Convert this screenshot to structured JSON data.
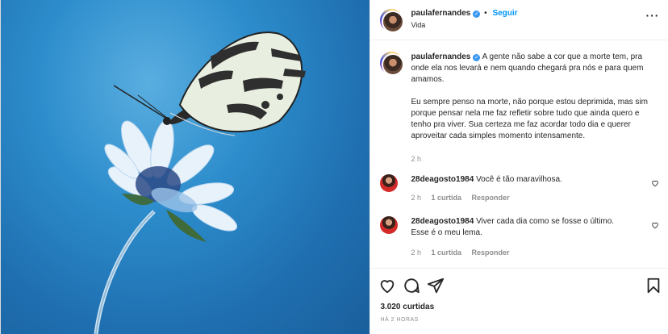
{
  "header": {
    "username": "paulafernandes",
    "follow_label": "Seguir",
    "location": "Vida",
    "more_icon": "more-horizontal-icon"
  },
  "caption": {
    "username": "paulafernandes",
    "paragraph1": "A gente não sabe a cor que a morte tem, pra onde ela nos levará e nem quando chegará pra nós e para quem amamos.",
    "paragraph2": "Eu sempre penso na morte, não porque estou deprimida, mas sim porque pensar nela me faz refletir sobre tudo que ainda quero e tenho pra viver. Sua certeza me faz acordar todo dia e querer aproveitar cada simples momento intensamente.",
    "time": "2 h"
  },
  "comments": [
    {
      "username": "28deagosto1984",
      "text": "Você é tão maravilhosa.",
      "time": "2 h",
      "likes": "1 curtida",
      "reply": "Responder"
    },
    {
      "username": "28deagosto1984",
      "text": "Viver cada dia como se fosse o último. Esse é o meu lema.",
      "time": "2 h",
      "likes": "1 curtida",
      "reply": "Responder"
    }
  ],
  "footer": {
    "likes": "3.020 curtidas",
    "ago": "HÁ 2 HORAS"
  },
  "colors": {
    "accent": "#0095f6",
    "verified": "#3897f0",
    "photo_bg": "#2d8dcc"
  }
}
